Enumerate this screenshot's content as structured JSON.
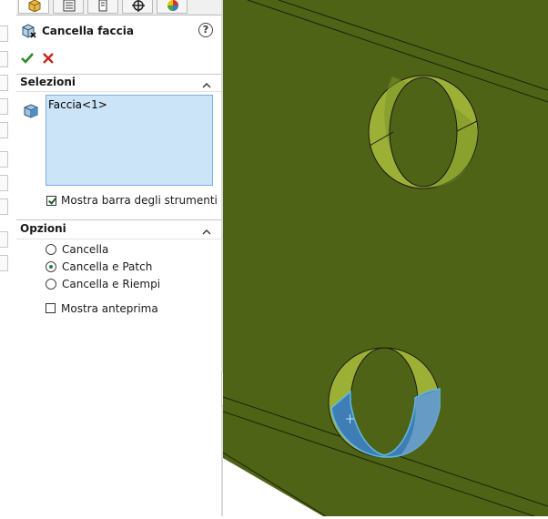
{
  "feature": {
    "title": "Cancella faccia",
    "help_label": "?"
  },
  "selections": {
    "title": "Selezioni",
    "items": [
      "Faccia<1>"
    ],
    "show_toolbar_label": "Mostra barra degli strumenti di"
  },
  "options": {
    "title": "Opzioni",
    "radios": [
      {
        "label": "Cancella",
        "checked": false
      },
      {
        "label": "Cancella e Patch",
        "checked": true
      },
      {
        "label": "Cancella e Riempi",
        "checked": false
      }
    ],
    "preview_label": "Mostra anteprima"
  },
  "colors": {
    "model_face": "#4f6316",
    "cylinder_wall": "#8ea12e",
    "selected_face": "#3e7eb4"
  }
}
